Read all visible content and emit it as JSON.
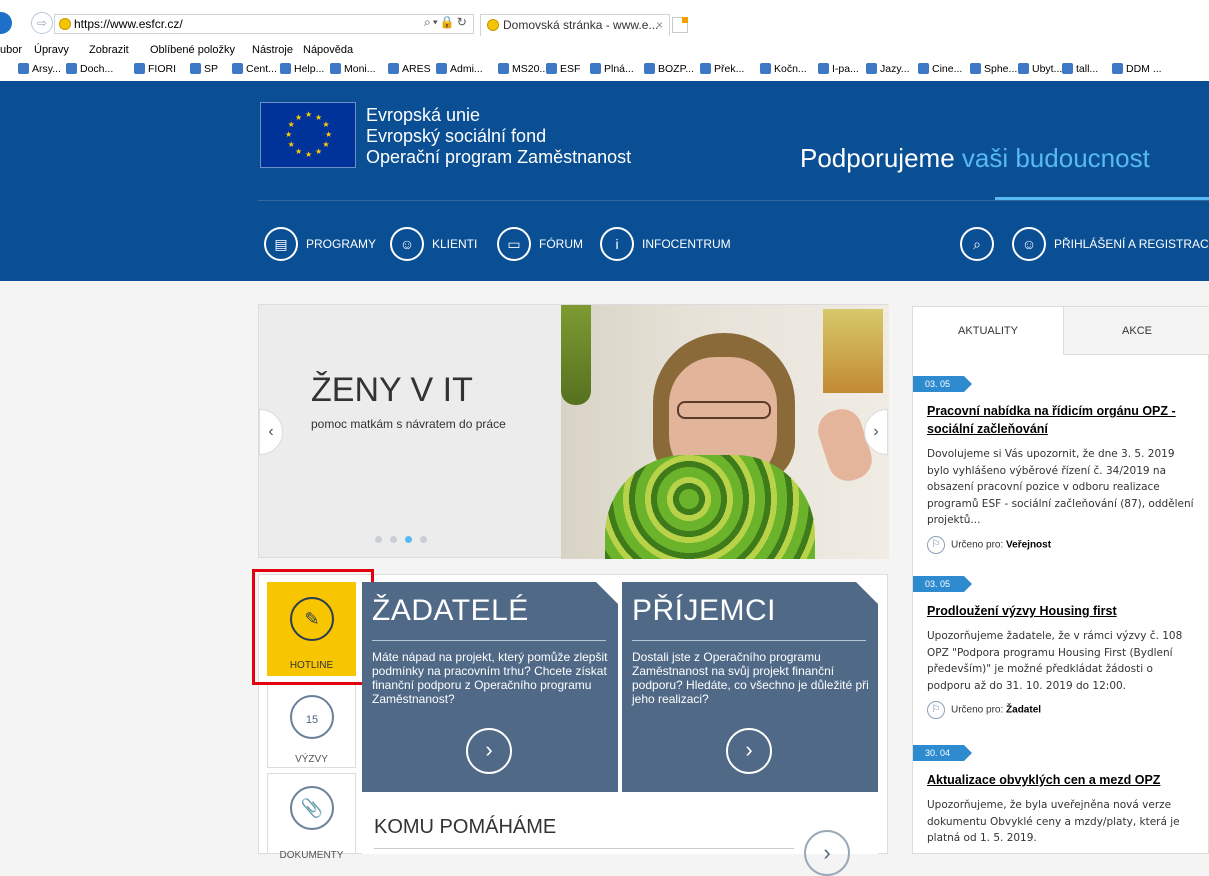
{
  "browser": {
    "url_host": "https://www.esfcr.cz/",
    "tab_title": "Domovská stránka - www.e...",
    "tab_close": "×",
    "menu": [
      "ubor",
      "Úpravy",
      "Zobrazit",
      "Oblíbené položky",
      "Nástroje",
      "Nápověda"
    ],
    "favorites": [
      "Arsy...",
      "Doch...",
      "FIORI",
      "SP",
      "Cent...",
      "Help...",
      "Moni...",
      "ARES",
      "Admi...",
      "MS20...",
      "ESF",
      "Plná...",
      "BOZP...",
      "Přek...",
      "Kočn...",
      "I-pa...",
      "Jazy...",
      "Cine...",
      "Sphe...",
      "Ubyt...",
      "tall...",
      "DDM ..."
    ]
  },
  "header": {
    "eu_line1": "Evropská unie",
    "eu_line2": "Evropský sociální fond",
    "eu_line3": "Operační program Zaměstnanost",
    "tagline_part1": "Podporujeme ",
    "tagline_part2": "vaši budoucnost"
  },
  "nav": {
    "programy": "PROGRAMY",
    "klienti": "KLIENTI",
    "forum": "FÓRUM",
    "infocentrum": "INFOCENTRUM",
    "login": "PŘIHLÁŠENÍ A REGISTRACE"
  },
  "slider": {
    "title": "ŽENY V IT",
    "subtitle": "pomoc matkám s návratem do práce",
    "prev": "‹",
    "next": "›",
    "slide_count": 4,
    "active_slide": 3
  },
  "quick": {
    "hotline": "HOTLINE",
    "vyzvy": "VÝZVY",
    "vyzvy_icon_num": "15",
    "dokumenty": "DOKUMENTY"
  },
  "cards": {
    "zadatele_title": "ŽADATELÉ",
    "zadatele_text": "Máte nápad na projekt, který pomůže zlepšit podmínky na pracovním trhu? Chcete získat finanční podporu z Operačního programu Zaměstnanost?",
    "prijemci_title": "PŘÍJEMCI",
    "prijemci_text": "Dostali jste z Operačního programu Zaměstnanost na svůj projekt finanční podporu? Hledáte, co všechno je důležité při jeho realizaci?",
    "komu_title": "KOMU POMÁHÁME"
  },
  "news": {
    "tab_aktuality": "AKTUALITY",
    "tab_akce": "AKCE",
    "for_label": "Určeno pro:",
    "items": [
      {
        "date": "03. 05",
        "title": "Pracovní nabídka na řídicím orgánu OPZ - sociální začleňování",
        "body": "Dovolujeme si Vás upozornit, že dne 3. 5. 2019 bylo vyhlášeno výběrové řízení č. 34/2019 na obsazení pracovní pozice v odboru realizace programů ESF - sociální začleňování (87), oddělení projektů...",
        "for": "Veřejnost"
      },
      {
        "date": "03. 05",
        "title": "Prodloužení výzvy Housing first",
        "body": "Upozorňujeme žadatele, že v rámci výzvy č. 108 OPZ \"Podpora programu Housing First (Bydlení především)\" je možné předkládat žádosti o podporu až do 31. 10. 2019 do 12:00.",
        "for": "Žadatel"
      },
      {
        "date": "30. 04",
        "title": "Aktualizace obvyklých cen a mezd OPZ",
        "body": "Upozorňujeme, že byla uveřejněna nová verze dokumentu Obvyklé ceny a mzdy/platy, která je platná od 1. 5. 2019.",
        "for": ""
      }
    ]
  }
}
